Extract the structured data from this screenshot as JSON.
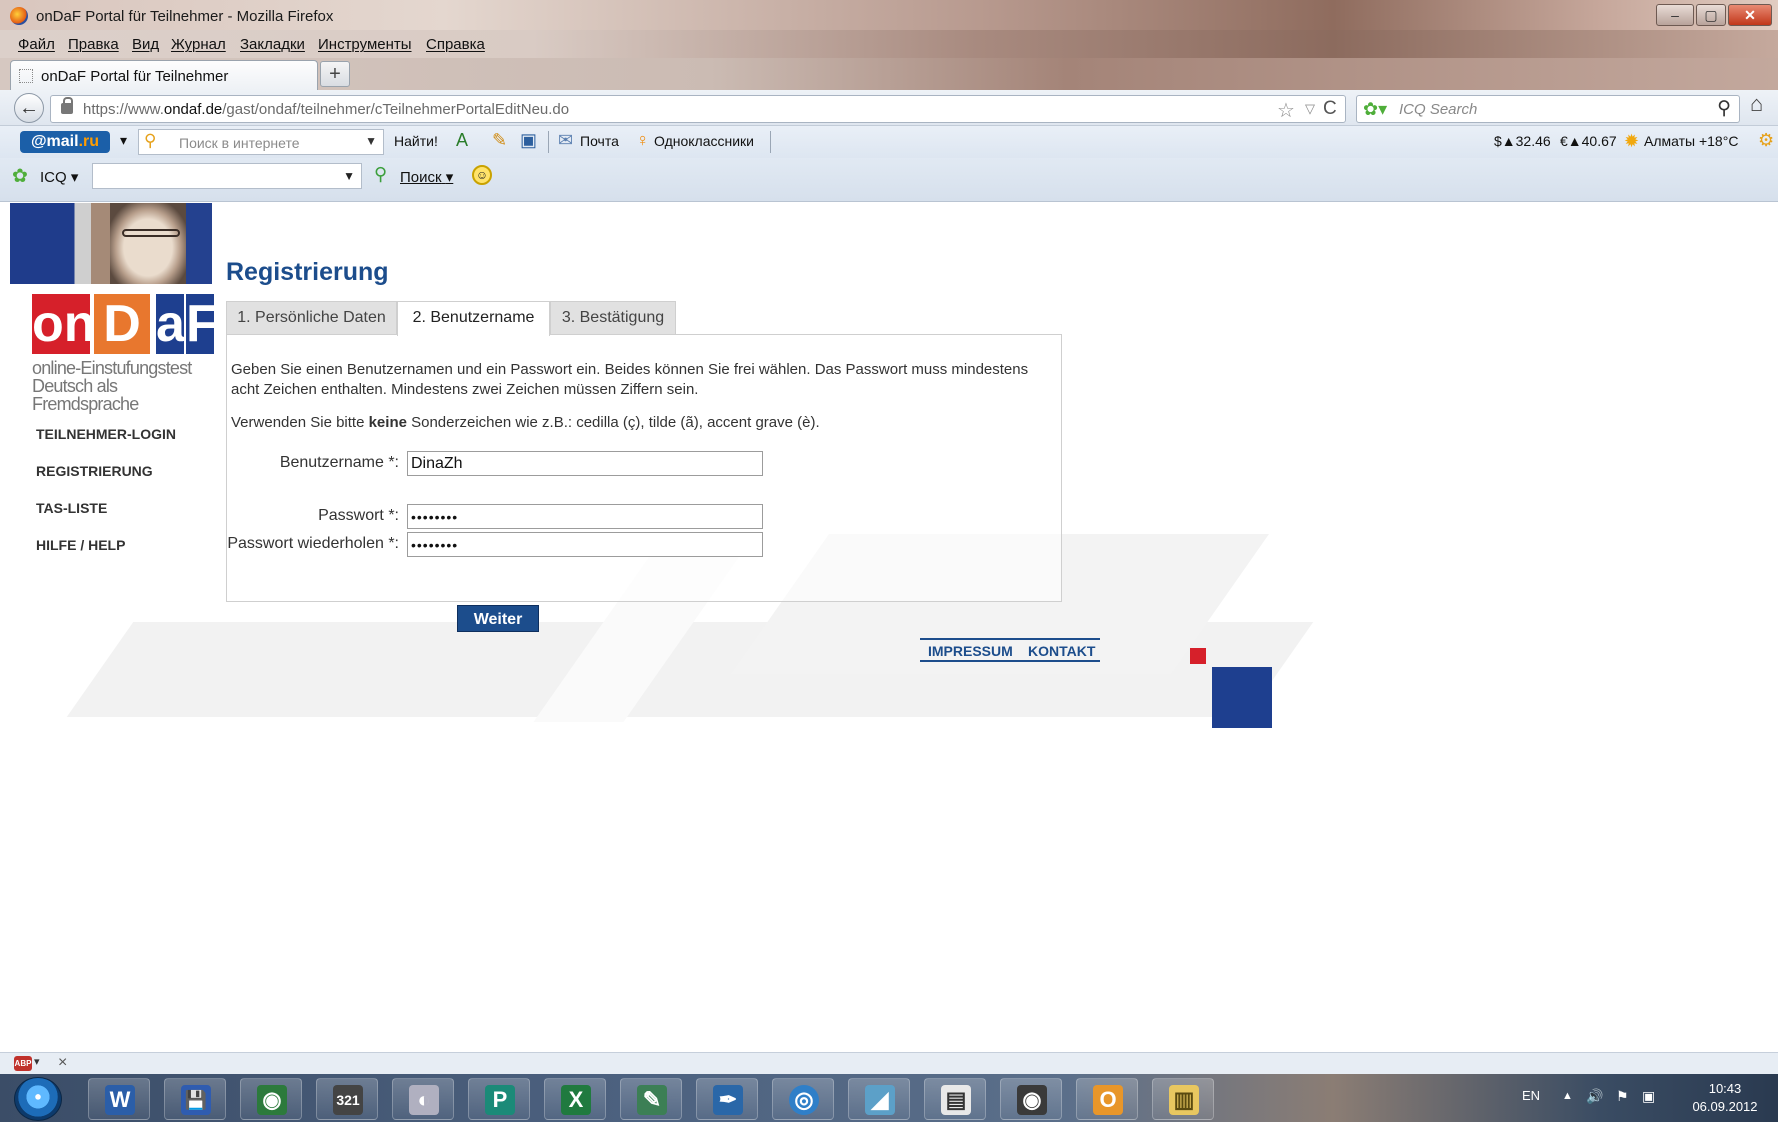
{
  "window": {
    "title": "onDaF Portal für Teilnehmer - Mozilla Firefox",
    "min": "–",
    "max": "▢",
    "close": "✕"
  },
  "menu": [
    "Файл",
    "Правка",
    "Вид",
    "Журнал",
    "Закладки",
    "Инструменты",
    "Справка"
  ],
  "tab": {
    "title": "onDaF Portal für Teilnehmer",
    "new_tab": "+"
  },
  "nav": {
    "back": "←",
    "url_pre": "https://www.",
    "url_host": "ondaf.de",
    "url_path": "/gast/ondaf/teilnehmer/cTeilnehmerPortalEditNeu.do",
    "star": "☆",
    "dropdown": "▽",
    "reload": "C",
    "search_placeholder": "ICQ Search",
    "home": "⌂"
  },
  "mailru_bar": {
    "logo_at": "@mail",
    "logo_ru": ".ru",
    "search_placeholder": "Поиск в интернете",
    "find": "Найти!",
    "mail": "Почта",
    "ok": "Одноклассники",
    "usd": "$▲32.46",
    "eur": "€▲40.67",
    "weather": "Алматы +18°C"
  },
  "icq_bar": {
    "label": "ICQ",
    "search": "Поиск",
    "arrow": "▾",
    "smile": "☺"
  },
  "sidebar": {
    "tagline1": "online-Einstufungstest",
    "tagline2": "Deutsch als Fremdsprache",
    "items": [
      "TEILNEHMER-LOGIN",
      "REGISTRIERUNG",
      "TAS-LISTE",
      "HILFE / HELP"
    ],
    "logo": [
      "on",
      "D",
      "a",
      "F"
    ],
    "logo_colors": [
      "#d6202a",
      "#e8772e",
      "#1e3f8f"
    ]
  },
  "main": {
    "title": "Registrierung",
    "steps": [
      "1. Persönliche Daten",
      "2. Benutzername",
      "3. Bestätigung"
    ],
    "active_step": 1,
    "para1": "Geben Sie einen Benutzernamen und ein Passwort ein. Beides können Sie frei wählen. Das Passwort muss mindestens acht Zeichen enthalten. Mindestens zwei Zeichen müssen Ziffern sein.",
    "para2_pre": "Verwenden Sie bitte ",
    "para2_bold": "keine",
    "para2_post": " Sonderzeichen wie z.B.: cedilla (ç), tilde (ã), accent grave (è).",
    "username_label": "Benutzername *:",
    "username_value": "DinaZh",
    "password_label": "Passwort *:",
    "password_value": "••••••••",
    "password_repeat_label": "Passwort wiederholen *:",
    "password_repeat_value": "••••••••",
    "submit": "Weiter"
  },
  "footer": {
    "impressum": "IMPRESSUM",
    "kontakt": "KONTAKT"
  },
  "addon_bar": {
    "abp": "ABP",
    "close": "×"
  },
  "taskbar": {
    "apps": [
      "W",
      "💾",
      "◉",
      "321",
      "◐",
      "P",
      "X",
      "✎",
      "✒",
      "◎",
      "◢",
      "▤",
      "◉",
      "O",
      "▥"
    ],
    "lang": "EN",
    "tray_up": "▲",
    "tray_vol": "🔊",
    "tray_flag": "⚑",
    "tray_net": "▣",
    "time": "10:43",
    "date": "06.09.2012"
  }
}
